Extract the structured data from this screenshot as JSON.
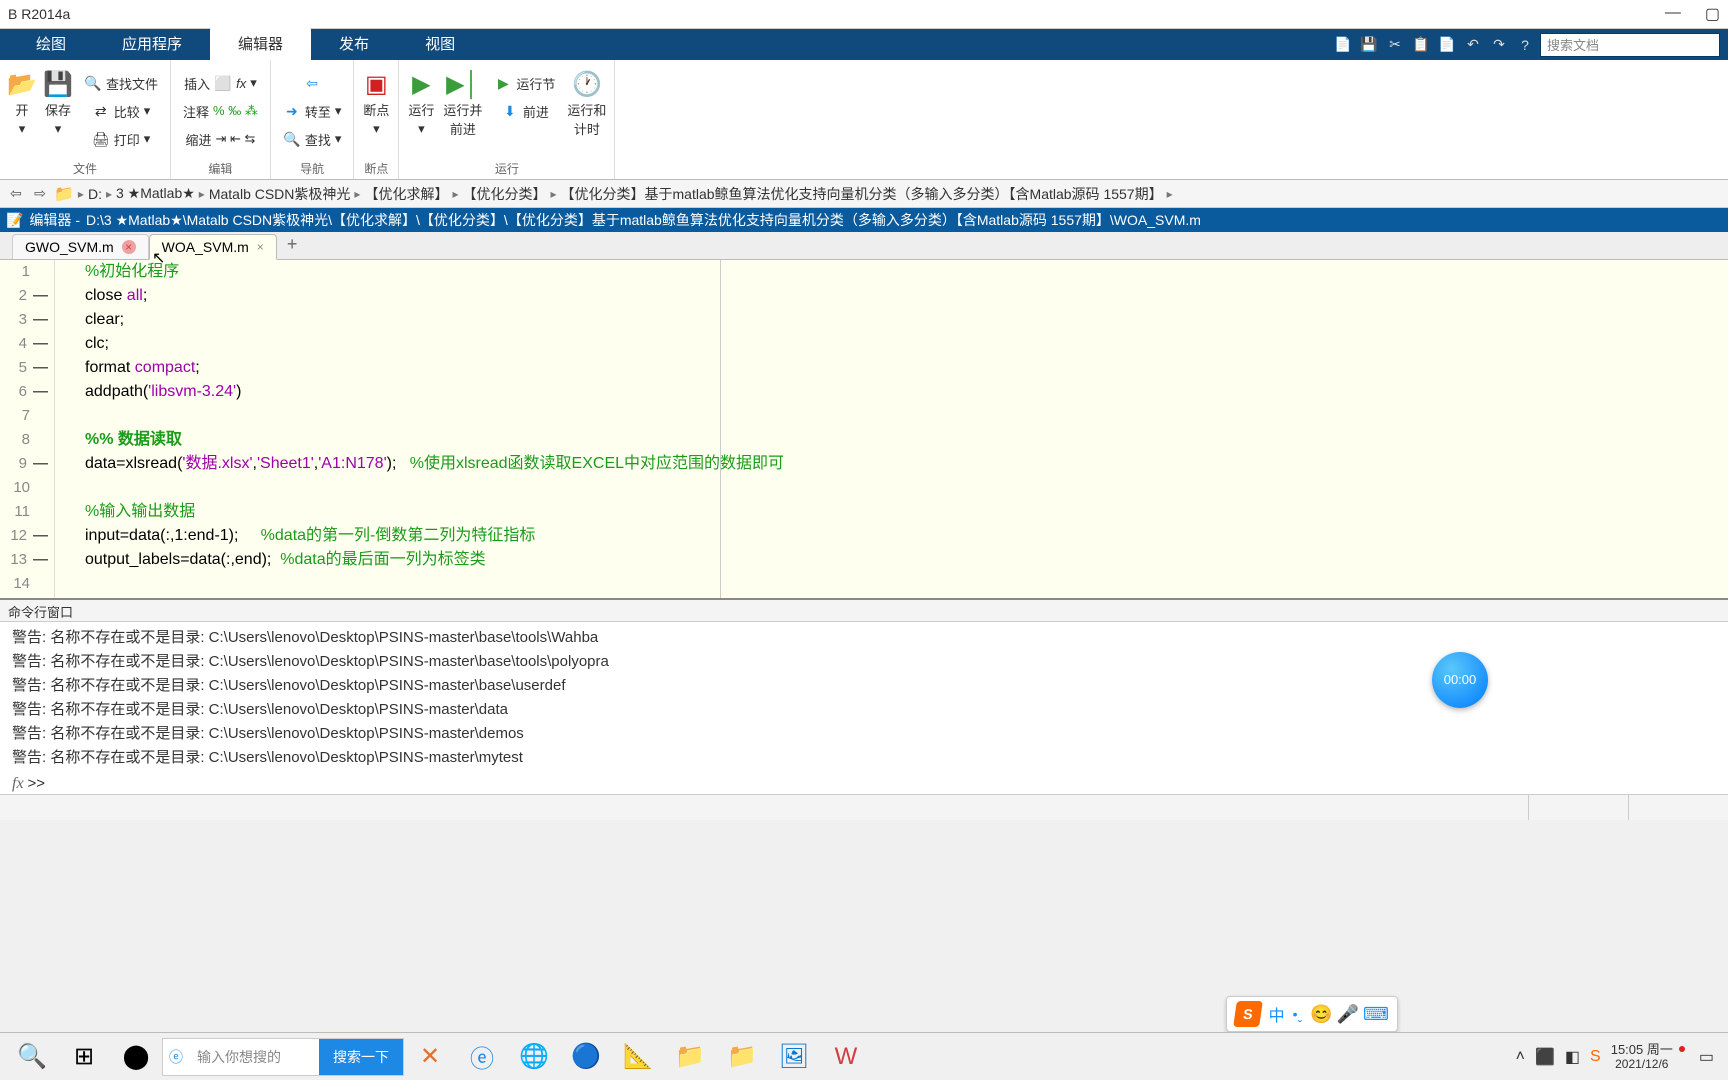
{
  "titlebar": {
    "text": "B R2014a"
  },
  "ribbon_tabs": {
    "plot": "绘图",
    "apps": "应用程序",
    "editor": "编辑器",
    "publish": "发布",
    "view": "视图"
  },
  "search": {
    "placeholder": "搜索文档"
  },
  "ribbon": {
    "file_group": "文件",
    "open": "开",
    "save": "保存",
    "find_files": "查找文件",
    "compare": "比较",
    "print": "打印",
    "edit_group": "编辑",
    "insert": "插入",
    "comment": "注释",
    "indent": "缩进",
    "nav_group": "导航",
    "goto": "转至",
    "find": "查找",
    "bp_group": "断点",
    "bp": "断点",
    "run_group": "运行",
    "run": "运行",
    "run_adv": "运行并\n前进",
    "run_sec": "运行节",
    "advance": "前进",
    "run_time": "运行和\n计时"
  },
  "breadcrumb": {
    "parts": [
      "D:",
      "3 ★Matlab★",
      "Matalb CSDN紫极神光",
      "【优化求解】",
      "【优化分类】",
      "【优化分类】基于matlab鲸鱼算法优化支持向量机分类（多输入多分类）【含Matlab源码 1557期】"
    ]
  },
  "editor_bar": {
    "prefix": "编辑器 - ",
    "path": "D:\\3 ★Matlab★\\Matalb CSDN紫极神光\\【优化求解】\\【优化分类】\\【优化分类】基于matlab鲸鱼算法优化支持向量机分类（多输入多分类）【含Matlab源码 1557期】\\WOA_SVM.m"
  },
  "tabs": {
    "tab1": "GWO_SVM.m",
    "tab2": "WOA_SVM.m"
  },
  "code": {
    "l1": "%初始化程序",
    "l2a": "close ",
    "l2b": "all",
    "l2c": ";",
    "l3": "clear;",
    "l4": "clc;",
    "l5a": "format ",
    "l5b": "compact",
    "l5c": ";",
    "l6a": "addpath(",
    "l6b": "'libsvm-3.24'",
    "l6c": ")",
    "l8": "%% 数据读取",
    "l9a": "data=xlsread(",
    "l9b": "'数据.xlsx'",
    "l9c": ",",
    "l9d": "'Sheet1'",
    "l9e": ",",
    "l9f": "'A1:N178'",
    "l9g": ");   ",
    "l9h": "%使用xlsread函数读取EXCEL中对应范围的数据即可",
    "l11": "%输入输出数据",
    "l12a": "input=data(:,1:end-1);     ",
    "l12b": "%data的第一列-倒数第二列为特征指标",
    "l13a": "output_labels=data(:,end);  ",
    "l13b": "%data的最后面一列为标签类"
  },
  "cmd": {
    "title": "命令行窗口",
    "lines": [
      "警告: 名称不存在或不是目录: C:\\Users\\lenovo\\Desktop\\PSINS-master\\base\\tools\\Wahba ",
      "警告: 名称不存在或不是目录: C:\\Users\\lenovo\\Desktop\\PSINS-master\\base\\tools\\polyopra ",
      "警告: 名称不存在或不是目录: C:\\Users\\lenovo\\Desktop\\PSINS-master\\base\\userdef ",
      "警告: 名称不存在或不是目录: C:\\Users\\lenovo\\Desktop\\PSINS-master\\data ",
      "警告: 名称不存在或不是目录: C:\\Users\\lenovo\\Desktop\\PSINS-master\\demos ",
      "警告: 名称不存在或不是目录: C:\\Users\\lenovo\\Desktop\\PSINS-master\\mytest "
    ],
    "prompt": ">>",
    "timer": "00:00"
  },
  "ime": {
    "text": "中"
  },
  "taskbar": {
    "search_placeholder": "输入你想搜的",
    "search_btn": "搜索一下",
    "time_top": "15:05 周一",
    "time_bot": "2021/12/6"
  }
}
